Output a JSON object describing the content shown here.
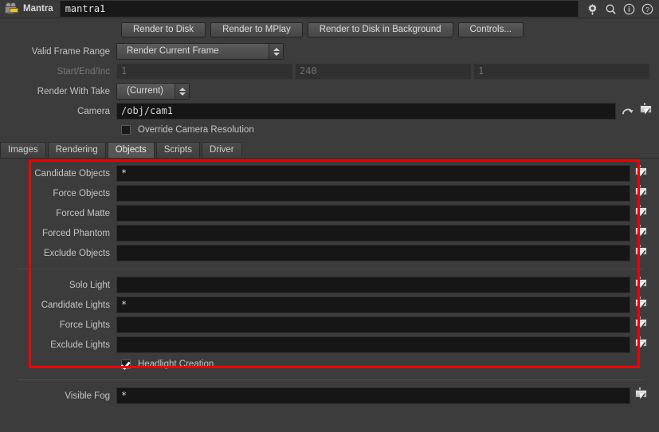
{
  "titlebar": {
    "node_icon": "mantra-node-icon",
    "node_type": "Mantra",
    "node_name": "mantra1",
    "icons": [
      {
        "name": "gear-icon",
        "glyph": "⚙"
      },
      {
        "name": "search-icon",
        "glyph": "⚲"
      },
      {
        "name": "info-icon",
        "glyph": "ⓘ"
      },
      {
        "name": "help-icon",
        "glyph": "?"
      }
    ]
  },
  "buttons": [
    {
      "name": "render-to-disk-button",
      "label": "Render to Disk"
    },
    {
      "name": "render-to-mplay-button",
      "label": "Render to MPlay"
    },
    {
      "name": "render-to-disk-background-button",
      "label": "Render to Disk in Background"
    },
    {
      "name": "controls-button",
      "label": "Controls..."
    }
  ],
  "params": {
    "valid_frame_range": {
      "label": "Valid Frame Range",
      "value": "Render Current Frame"
    },
    "start_end_inc": {
      "label": "Start/End/Inc",
      "start": "1",
      "end": "240",
      "inc": "1",
      "disabled": true
    },
    "render_with_take": {
      "label": "Render With Take",
      "value": "(Current)"
    },
    "camera": {
      "label": "Camera",
      "value": "/obj/cam1"
    },
    "override_camera_resolution": {
      "label": "Override Camera Resolution",
      "checked": false
    }
  },
  "tabs": [
    {
      "name": "tab-images",
      "label": "Images",
      "active": false
    },
    {
      "name": "tab-rendering",
      "label": "Rendering",
      "active": false
    },
    {
      "name": "tab-objects",
      "label": "Objects",
      "active": true
    },
    {
      "name": "tab-scripts",
      "label": "Scripts",
      "active": false
    },
    {
      "name": "tab-driver",
      "label": "Driver",
      "active": false
    }
  ],
  "objects_section": {
    "rows": [
      {
        "name": "candidate-objects",
        "label": "Candidate Objects",
        "value": "*"
      },
      {
        "name": "force-objects",
        "label": "Force Objects",
        "value": ""
      },
      {
        "name": "forced-matte",
        "label": "Forced Matte",
        "value": ""
      },
      {
        "name": "forced-phantom",
        "label": "Forced Phantom",
        "value": ""
      },
      {
        "name": "exclude-objects",
        "label": "Exclude Objects",
        "value": ""
      }
    ]
  },
  "lights_section": {
    "rows": [
      {
        "name": "solo-light",
        "label": "Solo Light",
        "value": ""
      },
      {
        "name": "candidate-lights",
        "label": "Candidate Lights",
        "value": "*"
      },
      {
        "name": "force-lights",
        "label": "Force Lights",
        "value": ""
      },
      {
        "name": "exclude-lights",
        "label": "Exclude Lights",
        "value": ""
      }
    ],
    "headlight_creation": {
      "label": "Headlight Creation",
      "checked": true
    }
  },
  "fog_section": {
    "rows": [
      {
        "name": "visible-fog",
        "label": "Visible Fog",
        "value": "*"
      }
    ]
  },
  "annotation": {
    "highlight_color": "#ef0000",
    "note": "red highlight rectangle around objects and lights parameters"
  }
}
